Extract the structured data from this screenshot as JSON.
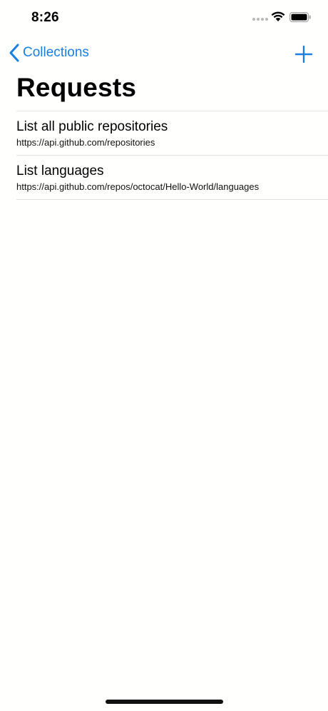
{
  "status_bar": {
    "time": "8:26"
  },
  "nav": {
    "back_label": "Collections",
    "back_icon": "chevron-left-icon",
    "add_icon": "plus-icon",
    "accent_color": "#1a7fe0"
  },
  "page": {
    "title": "Requests"
  },
  "requests": [
    {
      "title": "List all public repositories",
      "url": "https://api.github.com/repositories"
    },
    {
      "title": "List languages",
      "url": "https://api.github.com/repos/octocat/Hello-World/languages"
    }
  ]
}
